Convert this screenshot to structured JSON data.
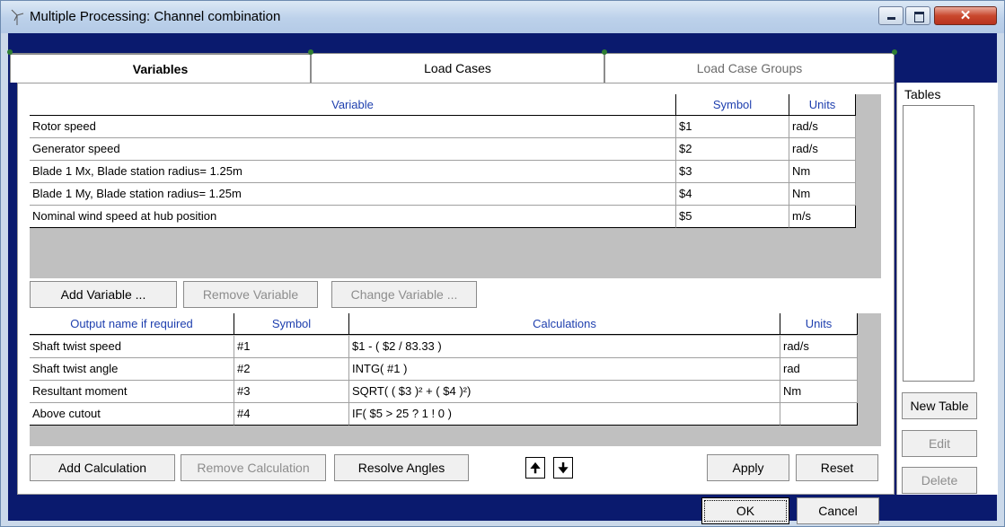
{
  "window": {
    "title": "Multiple Processing: Channel combination"
  },
  "tabs": [
    {
      "label": "Variables"
    },
    {
      "label": "Load Cases"
    },
    {
      "label": "Load Case Groups"
    }
  ],
  "variables": {
    "headers": {
      "variable": "Variable",
      "symbol": "Symbol",
      "units": "Units"
    },
    "rows": [
      {
        "variable": "Rotor speed",
        "symbol": "$1",
        "units": "rad/s"
      },
      {
        "variable": "Generator speed",
        "symbol": "$2",
        "units": "rad/s"
      },
      {
        "variable": "Blade 1 Mx, Blade station radius= 1.25m",
        "symbol": "$3",
        "units": "Nm"
      },
      {
        "variable": "Blade 1 My, Blade station radius= 1.25m",
        "symbol": "$4",
        "units": "Nm"
      },
      {
        "variable": "Nominal wind speed at hub position",
        "symbol": "$5",
        "units": "m/s"
      }
    ],
    "buttons": {
      "add": "Add Variable ...",
      "remove": "Remove Variable",
      "change": "Change Variable ..."
    }
  },
  "calculations": {
    "headers": {
      "output": "Output name if required",
      "symbol": "Symbol",
      "calc": "Calculations",
      "units": "Units"
    },
    "rows": [
      {
        "output": "Shaft twist speed",
        "symbol": "#1",
        "calc": "$1 - ( $2 / 83.33 )",
        "units": "rad/s"
      },
      {
        "output": "Shaft twist angle",
        "symbol": "#2",
        "calc": "INTG( #1 )",
        "units": "rad"
      },
      {
        "output": "Resultant moment",
        "symbol": "#3",
        "calc": "SQRT( ( $3 )² + ( $4 )²)",
        "units": "Nm"
      },
      {
        "output": "Above cutout",
        "symbol": "#4",
        "calc": "IF( $5 > 25 ? 1 ! 0 )",
        "units": ""
      }
    ],
    "buttons": {
      "add": "Add Calculation",
      "remove": "Remove Calculation",
      "resolve": "Resolve Angles",
      "up": "🠉",
      "down": "🠋",
      "apply": "Apply",
      "reset": "Reset"
    }
  },
  "tables": {
    "label": "Tables",
    "buttons": {
      "new": "New Table",
      "edit": "Edit",
      "delete": "Delete"
    }
  },
  "dialog": {
    "ok": "OK",
    "cancel": "Cancel"
  },
  "colors": {
    "header_text": "#1e3fae",
    "client_bg": "#0a1a6e",
    "grid_bg": "#c0c0c0"
  }
}
